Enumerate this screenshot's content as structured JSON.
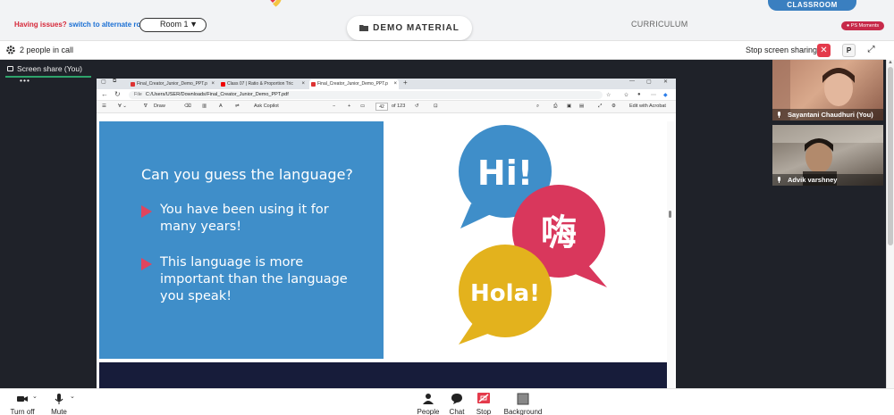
{
  "topbar": {
    "issues_question": "Having issues?",
    "issues_link": "switch to alternate room",
    "room_select": "Room 1",
    "demo_material": "DEMO MATERIAL",
    "curriculum": "CURRICULUM",
    "classroom_tab": "CLASSROOM",
    "ps_badge": "PS Moments"
  },
  "callbar": {
    "people_count": "2 people in call",
    "stop_sharing": "Stop screen sharing",
    "p_label": "P"
  },
  "stage": {
    "screen_share_tab": "Screen share (You)",
    "more_dots": "•••"
  },
  "browser": {
    "tabs": [
      "Final_Creator_Junior_Demo_PPT.p",
      "Class 07 | Ratio & Proportion Tric",
      "Final_Creator_Junior_Demo_PPT.p"
    ],
    "url_prefix": "File",
    "url": "C:/Users/USER/Downloads/Final_Creator_Junior_Demo_PPT.pdf",
    "pdf_toolbar": {
      "draw": "Draw",
      "ask_copilot": "Ask Copilot",
      "page": "42",
      "of_pages": "of 123",
      "edit_acrobat": "Edit with Acrobat"
    }
  },
  "slide": {
    "question": "Can you guess the language?",
    "bullets": [
      "You have been using it for many years!",
      "This language is more important than the language you speak!"
    ],
    "bubbles": {
      "hi": "Hi!",
      "chinese": "嗨",
      "hola": "Hola!"
    },
    "colors": {
      "blue": "#3f8ec9",
      "pink": "#d9375c",
      "yellow": "#e3b21d",
      "arrow": "#e0455e"
    }
  },
  "participants": [
    {
      "name": "Sayantani Chaudhuri (You)"
    },
    {
      "name": "Advik varshney"
    }
  ],
  "bottombar": {
    "turn_off": "Turn off",
    "mute": "Mute",
    "people": "People",
    "chat": "Chat",
    "stop": "Stop",
    "background": "Background"
  }
}
